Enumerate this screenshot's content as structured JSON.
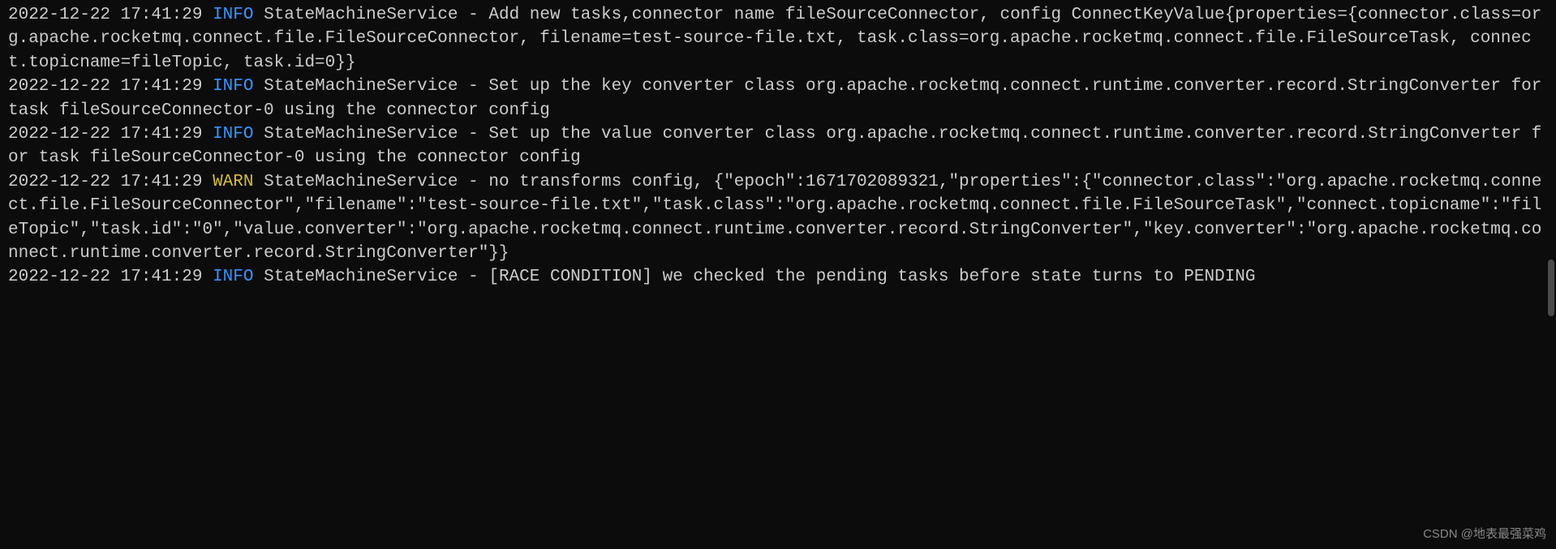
{
  "logs": [
    {
      "timestamp": "2022-12-22 17:41:29",
      "level": "INFO",
      "logger": "StateMachineService",
      "message": "Add new tasks,connector name fileSourceConnector, config ConnectKeyValue{properties={connector.class=org.apache.rocketmq.connect.file.FileSourceConnector, filename=test-source-file.txt, task.class=org.apache.rocketmq.connect.file.FileSourceTask, connect.topicname=fileTopic, task.id=0}}"
    },
    {
      "timestamp": "2022-12-22 17:41:29",
      "level": "INFO",
      "logger": "StateMachineService",
      "message": "Set up the key converter class org.apache.rocketmq.connect.runtime.converter.record.StringConverter for task fileSourceConnector-0 using the connector config"
    },
    {
      "timestamp": "2022-12-22 17:41:29",
      "level": "INFO",
      "logger": "StateMachineService",
      "message": "Set up the value converter class org.apache.rocketmq.connect.runtime.converter.record.StringConverter for task fileSourceConnector-0 using the connector config"
    },
    {
      "timestamp": "2022-12-22 17:41:29",
      "level": "WARN",
      "logger": "StateMachineService",
      "message": "no transforms config, {\"epoch\":1671702089321,\"properties\":{\"connector.class\":\"org.apache.rocketmq.connect.file.FileSourceConnector\",\"filename\":\"test-source-file.txt\",\"task.class\":\"org.apache.rocketmq.connect.file.FileSourceTask\",\"connect.topicname\":\"fileTopic\",\"task.id\":\"0\",\"value.converter\":\"org.apache.rocketmq.connect.runtime.converter.record.StringConverter\",\"key.converter\":\"org.apache.rocketmq.connect.runtime.converter.record.StringConverter\"}}"
    },
    {
      "timestamp": "2022-12-22 17:41:29",
      "level": "INFO",
      "logger": "StateMachineService",
      "message": "[RACE CONDITION] we checked the pending tasks before state turns to PENDING"
    }
  ],
  "watermark": "CSDN @地表最强菜鸡"
}
